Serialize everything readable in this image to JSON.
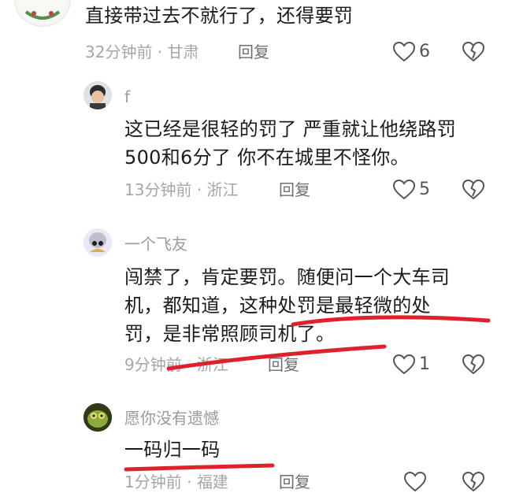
{
  "comments": [
    {
      "text": [
        "直接带过去不就行了，还得要罚"
      ],
      "time": "32分钟前",
      "location": "甘肃",
      "reply_label": "回复",
      "likes": "6"
    },
    {
      "user": "f",
      "text": [
        "这已经是很轻的罚了 严重就让他绕路罚",
        "500和6分了 你不在城里不怪你。"
      ],
      "time": "13分钟前",
      "location": "浙江",
      "reply_label": "回复",
      "likes": "5"
    },
    {
      "user": "一个飞友",
      "text": [
        "闯禁了，肯定要罚。随便问一个大车司",
        "机，都知道，这种处罚是最轻微的处",
        "罚，是非常照顾司机了。"
      ],
      "time": "9分钟前",
      "location": "浙江",
      "reply_label": "回复",
      "likes": "1"
    },
    {
      "user": "愿你没有遗憾",
      "text": [
        "一码归一码"
      ],
      "time": "1分钟前",
      "location": "福建",
      "reply_label": "回复",
      "likes": ""
    }
  ],
  "colors": {
    "annotation_red": "#e0212b",
    "meta_gray": "#a6a6a6"
  },
  "icons": [
    "heart-icon",
    "broken-heart-icon"
  ]
}
